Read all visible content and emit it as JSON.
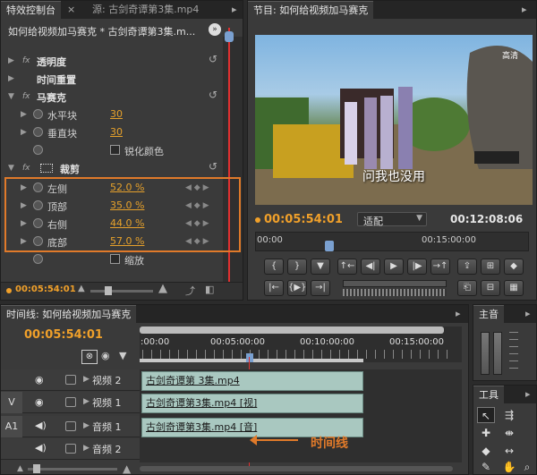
{
  "effect_controls": {
    "tabs": [
      "特效控制台",
      "源: 古剑奇谭第3集.mp4"
    ],
    "clip_title": "如何给视频加马赛克 * 古剑奇谭第3集.m...",
    "rows": {
      "opacity": "透明度",
      "time_remap": "时间重置",
      "mosaic": "马赛克",
      "h_blocks": "水平块",
      "h_blocks_val": "30",
      "v_blocks": "垂直块",
      "v_blocks_val": "30",
      "sharpen": "锐化颜色",
      "crop": "裁剪",
      "left": "左侧",
      "left_val": "52.0 %",
      "top": "顶部",
      "top_val": "35.0 %",
      "right": "右侧",
      "right_val": "44.0 %",
      "bottom": "底部",
      "bottom_val": "57.0 %",
      "zoom": "缩放"
    },
    "timecode": "00:05:54:01"
  },
  "program": {
    "tab": "节目: 如何给视频加马赛克",
    "subtitle": "问我也没用",
    "corner_text": "高清",
    "timecode": "00:05:54:01",
    "fit_select": "适配",
    "duration": "00:12:08:06",
    "ruler": [
      "00:00",
      "00:15:00:00"
    ]
  },
  "timeline": {
    "tab": "时间线: 如何给视频加马赛克",
    "timecode": "00:05:54:01",
    "ruler": [
      ":00:00",
      "00:05:00:00",
      "00:10:00:00",
      "00:15:00:00"
    ],
    "tracks": {
      "video2": "视频 2",
      "video1": "视频 1",
      "audio1": "音频 1",
      "audio2": "音频 2",
      "v_label": "V",
      "a_label": "A1"
    },
    "clips": {
      "v2": "古剑奇谭第 3集.mp4",
      "v1": "古剑奇谭第3集.mp4 [视]",
      "a1": "古剑奇谭第3集.mp4 [音]"
    },
    "annotation": "时间线"
  },
  "audio_panel": {
    "tab": "主音"
  },
  "tools_panel": {
    "tab": "工具"
  },
  "colors": {
    "accent": "#f0a02a",
    "playhead": "#e03030",
    "clip": "#a9c8c0",
    "highlight_box": "#e07a2a"
  }
}
